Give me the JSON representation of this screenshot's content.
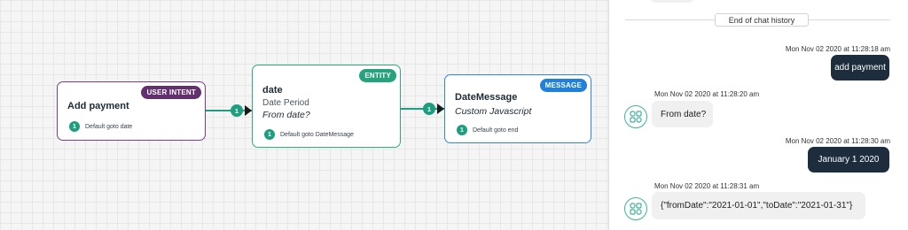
{
  "flow": {
    "nodes": [
      {
        "badge": "USER INTENT",
        "title": "Add payment",
        "subtitle": "",
        "description": "",
        "port_num": "1",
        "port_label": "Default goto date"
      },
      {
        "badge": "ENTITY",
        "title": "date",
        "subtitle": "Date Period",
        "description": "From date?",
        "port_num": "1",
        "port_label": "Default goto DateMessage"
      },
      {
        "badge": "MESSAGE",
        "title": "DateMessage",
        "subtitle": "",
        "description": "Custom Javascript",
        "port_num": "1",
        "port_label": "Default goto end"
      }
    ],
    "connectors": [
      {
        "num": "1"
      },
      {
        "num": "1"
      }
    ],
    "colors": {
      "intent": "#62306f",
      "entity": "#25a37c",
      "message": "#1f80e0",
      "connector": "#1f9e7f"
    }
  },
  "chat": {
    "history_label": "End of chat history",
    "messages": [
      {
        "sender": "user",
        "timestamp": "Mon Nov 02 2020 at 11:28:18 am",
        "text": "add payment"
      },
      {
        "sender": "bot",
        "timestamp": "Mon Nov 02 2020 at 11:28:20 am",
        "text": "From date?"
      },
      {
        "sender": "user",
        "timestamp": "Mon Nov 02 2020 at 11:28:30 am",
        "text": "January 1 2020"
      },
      {
        "sender": "bot",
        "timestamp": "Mon Nov 02 2020 at 11:28:31 am",
        "text": "{\"fromDate\":\"2021-01-01\",\"toDate\":\"2021-01-31\"}"
      }
    ],
    "colors": {
      "user_bubble": "#1e2d3d",
      "bot_bubble": "#f0f0f0",
      "avatar_border": "#3fb39b"
    }
  }
}
